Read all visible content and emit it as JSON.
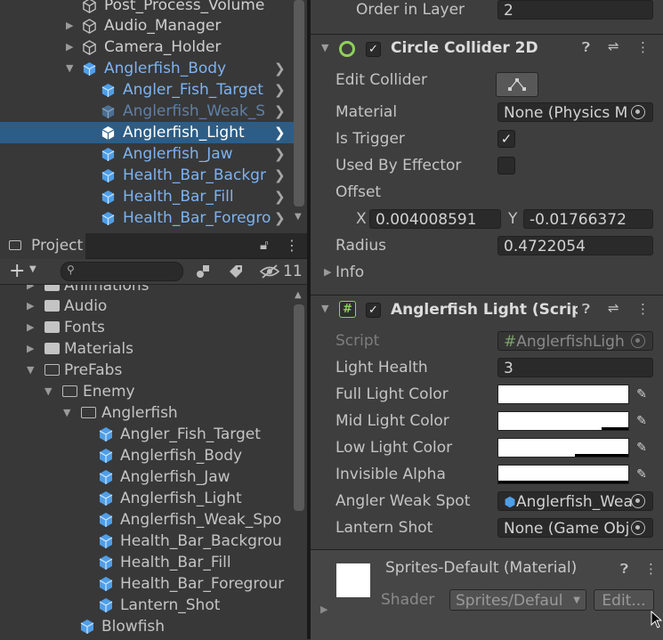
{
  "hierarchy": {
    "items": [
      {
        "label": "Post_Process_Volume",
        "color": "grey",
        "icon": "gameobject-icon"
      },
      {
        "label": "Audio_Manager",
        "color": "grey",
        "icon": "gameobject-icon"
      },
      {
        "label": "Camera_Holder",
        "color": "grey",
        "icon": "gameobject-icon"
      },
      {
        "label": "Anglerfish_Body",
        "color": "blue",
        "icon": "prefab-icon"
      },
      {
        "label": "Angler_Fish_Target",
        "color": "blue",
        "icon": "prefab-icon"
      },
      {
        "label": "Anglerfish_Weak_S",
        "color": "dimblue",
        "icon": "prefab-icon"
      },
      {
        "label": "Anglerfish_Light",
        "color": "white",
        "icon": "prefab-icon",
        "selected": true
      },
      {
        "label": "Anglerfish_Jaw",
        "color": "blue",
        "icon": "prefab-icon"
      },
      {
        "label": "Health_Bar_Backgr",
        "color": "blue",
        "icon": "prefab-icon"
      },
      {
        "label": "Health_Bar_Fill",
        "color": "blue",
        "icon": "prefab-icon"
      },
      {
        "label": "Health_Bar_Foregro",
        "color": "blue",
        "icon": "prefab-icon"
      }
    ]
  },
  "project": {
    "tab_label": "Project",
    "hidden_count": "11",
    "items": [
      {
        "label": "Animations",
        "type": "folder"
      },
      {
        "label": "Audio",
        "type": "folder"
      },
      {
        "label": "Fonts",
        "type": "folder"
      },
      {
        "label": "Materials",
        "type": "folder"
      },
      {
        "label": "PreFabs",
        "type": "open-folder"
      },
      {
        "label": "Enemy",
        "type": "open-folder"
      },
      {
        "label": "Anglerfish",
        "type": "open-folder"
      },
      {
        "label": "Angler_Fish_Target",
        "type": "prefab"
      },
      {
        "label": "Anglerfish_Body",
        "type": "prefab"
      },
      {
        "label": "Anglerfish_Jaw",
        "type": "prefab"
      },
      {
        "label": "Anglerfish_Light",
        "type": "prefab"
      },
      {
        "label": "Anglerfish_Weak_Spo",
        "type": "prefab"
      },
      {
        "label": "Health_Bar_Backgrou",
        "type": "prefab"
      },
      {
        "label": "Health_Bar_Fill",
        "type": "prefab"
      },
      {
        "label": "Health_Bar_Foregrour",
        "type": "prefab"
      },
      {
        "label": "Lantern_Shot",
        "type": "prefab"
      },
      {
        "label": "Blowfish",
        "type": "prefab"
      }
    ]
  },
  "inspector": {
    "order_in_layer": {
      "label": "Order in Layer",
      "value": "2"
    },
    "circle_collider": {
      "title": "Circle Collider 2D",
      "edit_collider": "Edit Collider",
      "material_label": "Material",
      "material_value": "None (Physics M",
      "is_trigger_label": "Is Trigger",
      "used_by_effector_label": "Used By Effector",
      "offset_label": "Offset",
      "x_label": "X",
      "x_value": "0.004008591",
      "y_label": "Y",
      "y_value": "-0.01766372",
      "radius_label": "Radius",
      "radius_value": "0.4722054",
      "info_label": "Info"
    },
    "script_component": {
      "title": "Anglerfish Light (Scrip",
      "script_label": "Script",
      "script_value": "AnglerfishLigh",
      "light_health_label": "Light Health",
      "light_health_value": "3",
      "full_light_label": "Full Light Color",
      "mid_light_label": "Mid Light Color",
      "low_light_label": "Low Light Color",
      "invisible_alpha_label": "Invisible Alpha",
      "angler_weak_spot_label": "Angler Weak Spot",
      "angler_weak_spot_value": "Anglerfish_Wea",
      "lantern_shot_label": "Lantern Shot",
      "lantern_shot_value": "None (Game Obj"
    },
    "material": {
      "title": "Sprites-Default (Material)",
      "shader_label": "Shader",
      "shader_value": "Sprites/Defaul",
      "edit_button": "Edit..."
    }
  },
  "colors": {
    "selection": "#2c5d87",
    "prefab_blue": "#7cb3f2",
    "dim_blue": "#5f7fa6",
    "accent_green": "#8fd15b"
  }
}
